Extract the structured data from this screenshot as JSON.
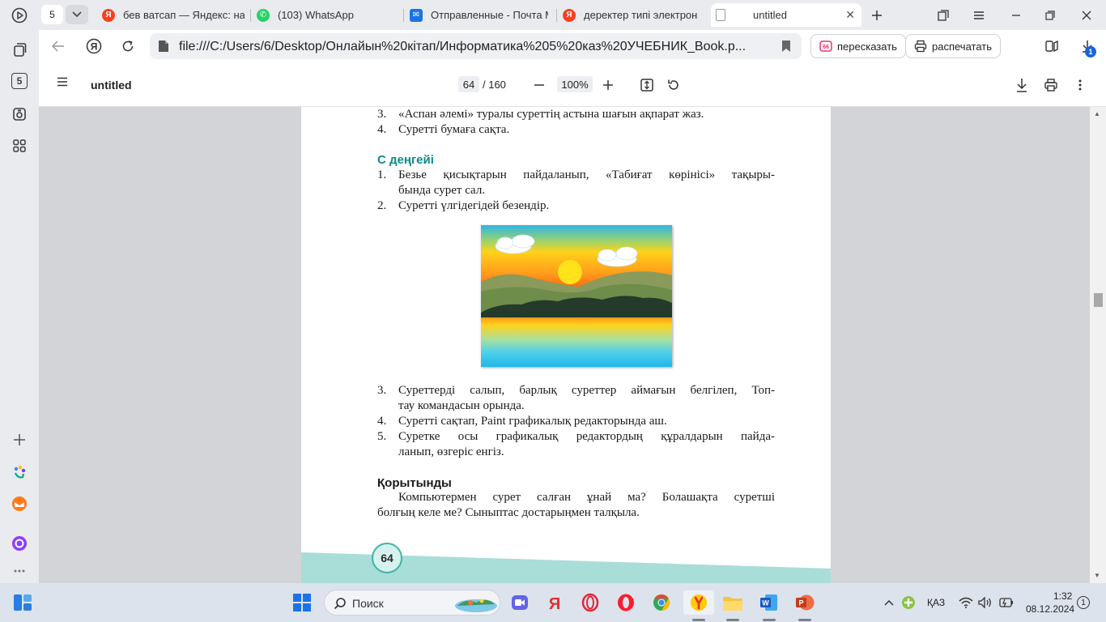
{
  "sidebar": {
    "tabs_count_badge": "5"
  },
  "tabs": {
    "count": "5",
    "items": [
      {
        "label": "бев ватсап — Яндекс: на",
        "icon": "yandex-icon",
        "color": "#fc3f1d"
      },
      {
        "label": "(103) WhatsApp",
        "icon": "whatsapp-icon",
        "color": "#25d366"
      },
      {
        "label": "Отправленные - Почта Mail",
        "icon": "mail-icon",
        "color": "#1a73e8"
      },
      {
        "label": "деректер типі электрон",
        "icon": "yandex-icon",
        "color": "#fc3f1d"
      },
      {
        "label": "untitled",
        "icon": "pdf-file-icon",
        "color": "#888888",
        "active": true
      }
    ]
  },
  "address": {
    "url": "file:///C:/Users/6/Desktop/Онлайын%20кітап/Информатика%205%20каз%20УЧЕБНИК_Book.p...",
    "retell_label": "пересказать",
    "print_label": "распечатать",
    "downloads_badge": "1"
  },
  "pdf_toolbar": {
    "title": "untitled",
    "current_page": "64",
    "total_pages": "/ 160",
    "zoom": "100%"
  },
  "document": {
    "top_items": [
      {
        "num": "3.",
        "text": "«Аспан әлемі» туралы суреттің астына шағын ақпарат жаз."
      },
      {
        "num": "4.",
        "text": "Суретті бумаға сақта."
      }
    ],
    "level_c_heading": "С деңгейі",
    "level_c_items": [
      {
        "num": "1.",
        "lines": [
          "Безье қисықтарын пайдаланып, «Табиғат көрінісі» тақыры-",
          "бында сурет сал."
        ]
      },
      {
        "num": "2.",
        "lines": [
          "Суретті үлгідегідей безендір."
        ]
      }
    ],
    "after_items": [
      {
        "num": "3.",
        "lines": [
          "Суреттерді салып, барлық суреттер аймағын белгілеп, Топ-",
          "тау командасын орында."
        ]
      },
      {
        "num": "4.",
        "lines": [
          "Суретті сақтап, Paint графикалық редакторында аш."
        ]
      },
      {
        "num": "5.",
        "lines": [
          "Суретке осы графикалық редактордың құралдарын пайда-",
          "ланып, өзгеріс енгіз."
        ]
      }
    ],
    "conclusion_heading": "Қорытынды",
    "conclusion_lines": [
      "Компьютермен сурет салған ұнай ма? Болашақта суретші",
      "болғың келе ме? Сыныптас достарыңмен талқыла."
    ],
    "page_number": "64",
    "accent_color": "#0d8a8a"
  },
  "taskbar": {
    "search_label": "Поиск",
    "language": "ҚАЗ",
    "time": "1:32",
    "date": "08.12.2024",
    "notification_count": "1"
  }
}
